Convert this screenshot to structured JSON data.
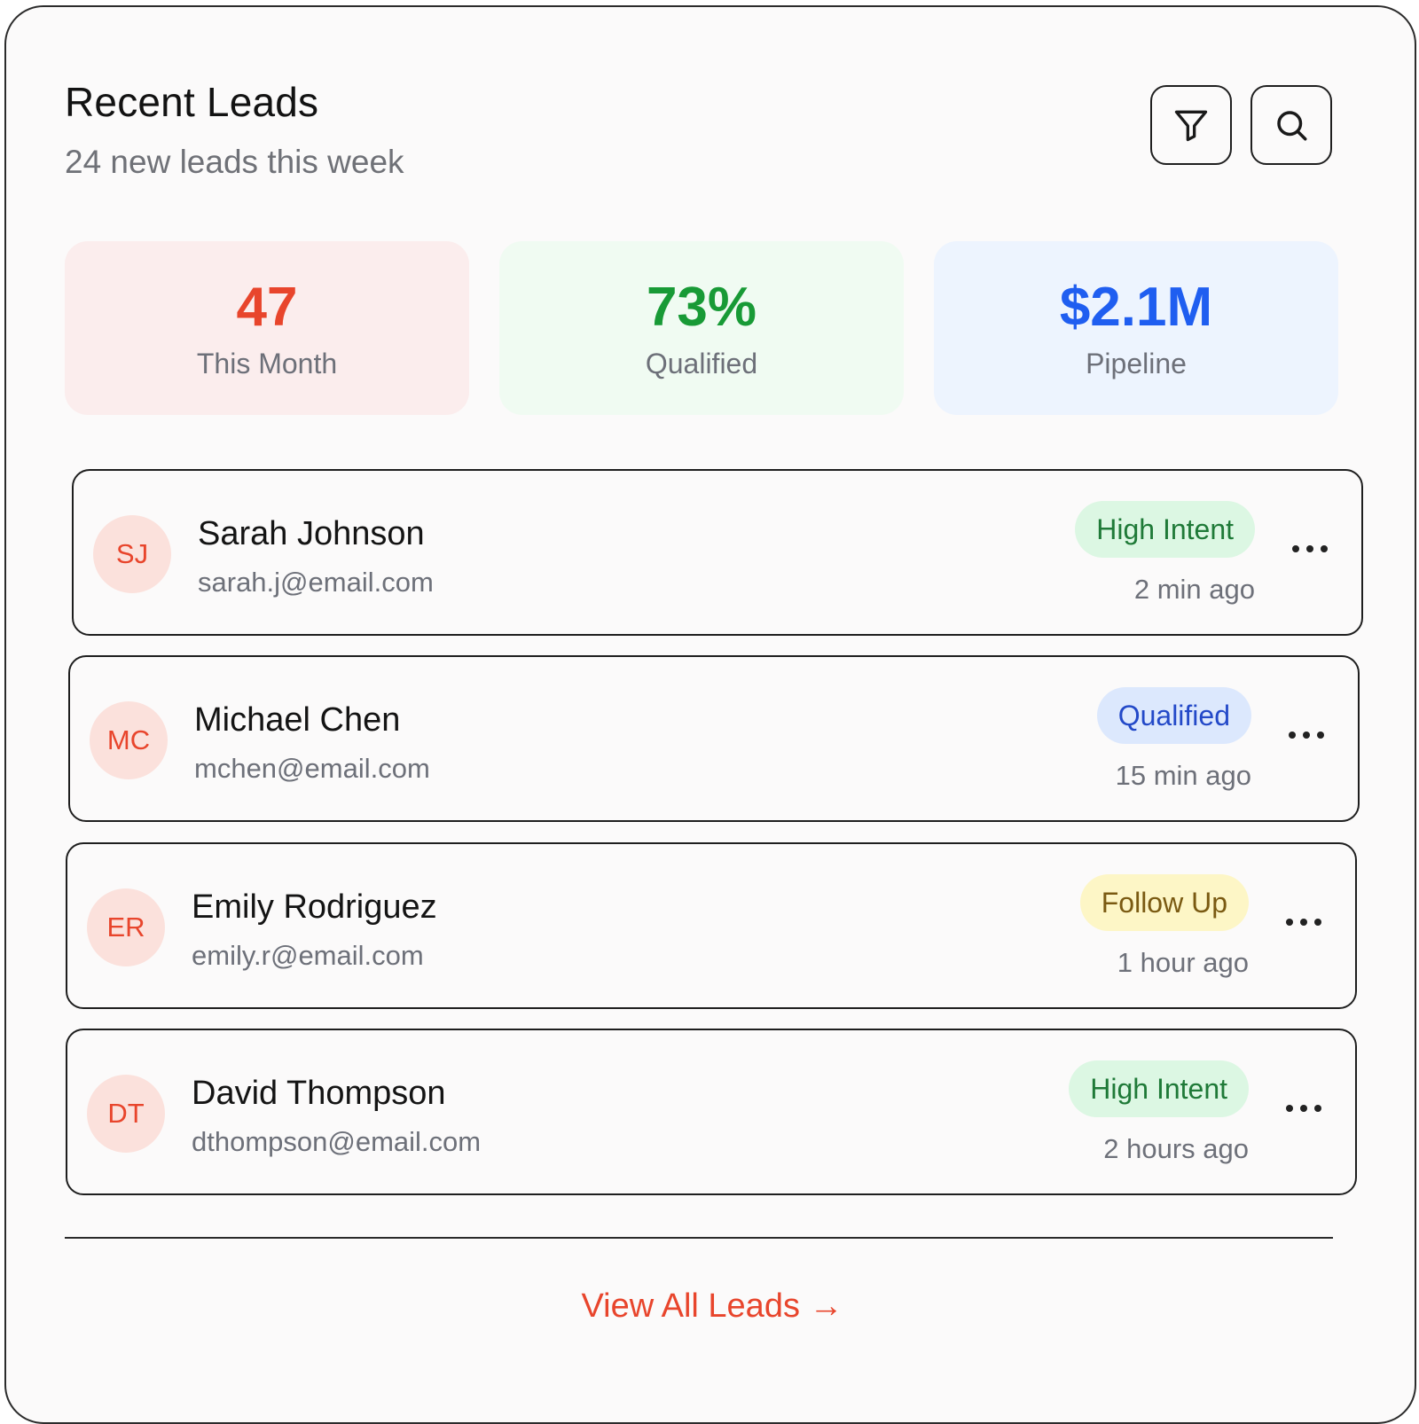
{
  "header": {
    "title": "Recent Leads",
    "subtitle": "24 new leads this week",
    "actions": [
      {
        "icon": "filter-icon"
      },
      {
        "icon": "search-icon"
      }
    ]
  },
  "stats": [
    {
      "value": "47",
      "label": "This Month",
      "color": "#e8452c",
      "bg": "#fbeded"
    },
    {
      "value": "73%",
      "label": "Qualified",
      "color": "#189a36",
      "bg": "#f0fbf2"
    },
    {
      "value": "$2.1M",
      "label": "Pipeline",
      "color": "#1f5ef0",
      "bg": "#edf4fe"
    }
  ],
  "leads": [
    {
      "initials": "SJ",
      "name": "Sarah Johnson",
      "email": "sarah.j@email.com",
      "status": "High Intent",
      "status_color": "#1f7a38",
      "status_bg": "#dcf7e3",
      "time": "2 min ago"
    },
    {
      "initials": "MC",
      "name": "Michael Chen",
      "email": "mchen@email.com",
      "status": "Qualified",
      "status_color": "#2349c8",
      "status_bg": "#dce8fd",
      "time": "15 min ago"
    },
    {
      "initials": "ER",
      "name": "Emily Rodriguez",
      "email": "emily.r@email.com",
      "status": "Follow Up",
      "status_color": "#7a5a12",
      "status_bg": "#fdf6c6",
      "time": "1 hour ago"
    },
    {
      "initials": "DT",
      "name": "David Thompson",
      "email": "dthompson@email.com",
      "status": "High Intent",
      "status_color": "#1f7a38",
      "status_bg": "#dcf7e3",
      "time": "2 hours ago"
    }
  ],
  "footer": {
    "link_label": "View All Leads →"
  }
}
